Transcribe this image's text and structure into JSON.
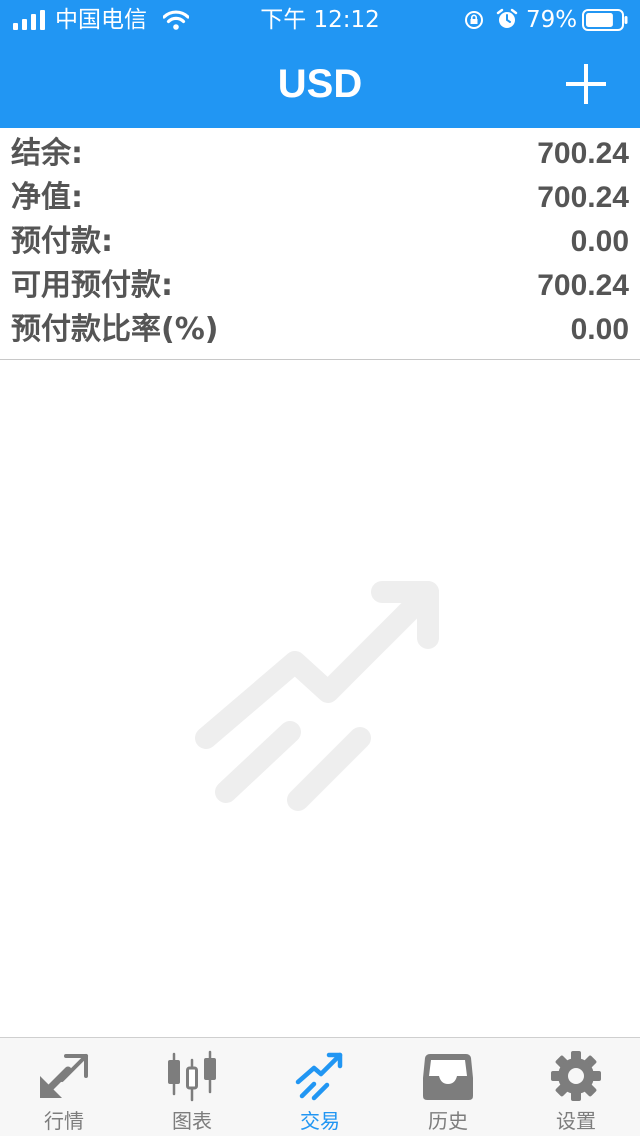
{
  "status_bar": {
    "carrier": "中国电信",
    "time": "下午 12:12",
    "battery_percent": "79%",
    "battery_level": 0.79
  },
  "navbar": {
    "title": "USD",
    "add_icon": "plus-icon"
  },
  "account_summary": {
    "rows": [
      {
        "label": "结余:",
        "value": "700.24"
      },
      {
        "label": "净值:",
        "value": "700.24"
      },
      {
        "label": "预付款:",
        "value": "0.00"
      },
      {
        "label": "可用预付款:",
        "value": "700.24"
      },
      {
        "label": "预付款比率(%)",
        "value": "0.00"
      }
    ]
  },
  "empty_state": {
    "icon": "trade-arrow-icon"
  },
  "tab_bar": {
    "active": "trade",
    "tabs": [
      {
        "id": "quotes",
        "label": "行情",
        "icon": "quotes-arrows-icon"
      },
      {
        "id": "charts",
        "label": "图表",
        "icon": "candlestick-icon"
      },
      {
        "id": "trade",
        "label": "交易",
        "icon": "trade-arrow-icon"
      },
      {
        "id": "history",
        "label": "历史",
        "icon": "inbox-icon"
      },
      {
        "id": "settings",
        "label": "设置",
        "icon": "gear-icon"
      }
    ]
  },
  "colors": {
    "primary": "#2196f3",
    "text": "#555555",
    "tab_inactive": "#7d7d7d",
    "watermark": "#eeeeee"
  }
}
